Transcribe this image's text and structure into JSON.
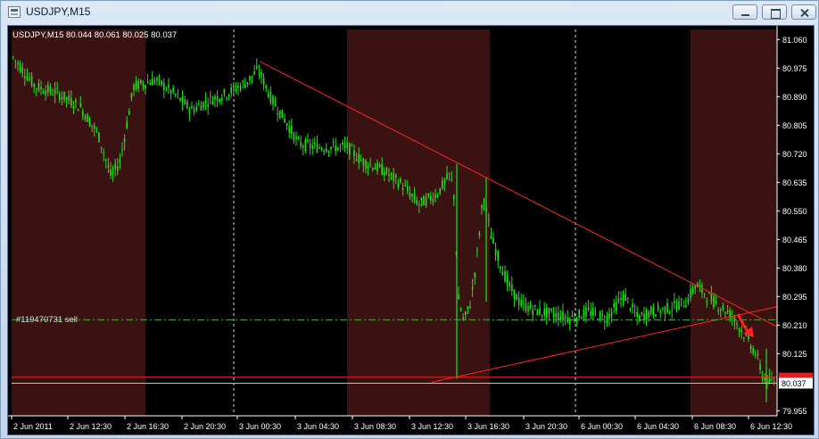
{
  "window": {
    "title": "USDJPY,M15"
  },
  "chart_data": {
    "type": "candlestick",
    "symbol_label": "USDJPY,M15",
    "ohlc_label": "80.044 80.061 80.025 80.037",
    "current_price": "80.037",
    "price_ticks": [
      "81.060",
      "80.975",
      "80.890",
      "80.805",
      "80.720",
      "80.635",
      "80.550",
      "80.465",
      "80.380",
      "80.295",
      "80.210",
      "80.125",
      "79.955"
    ],
    "time_ticks": [
      "2 Jun 2011",
      "2 Jun 12:30",
      "2 Jun 16:30",
      "2 Jun 20:30",
      "3 Jun 00:30",
      "3 Jun 04:30",
      "3 Jun 08:30",
      "3 Jun 12:30",
      "3 Jun 16:30",
      "3 Jun 20:30",
      "6 Jun 00:30",
      "6 Jun 04:30",
      "6 Jun 08:30",
      "6 Jun 12:30"
    ],
    "order_label": "#119470731 sell",
    "order_price": 80.226,
    "ylim": [
      79.94,
      81.09
    ],
    "trendlines": [
      {
        "from": [
          "3 Jun 00:30",
          80.995
        ],
        "to": [
          "6 Jun 12:30",
          80.205
        ],
        "color": "#ff2020"
      },
      {
        "from": [
          "3 Jun 12:30",
          80.04
        ],
        "to": [
          "6 Jun 12:30",
          80.265
        ],
        "color": "#ff2020"
      }
    ],
    "hlines": [
      {
        "price": 80.055,
        "color": "#ff2020"
      },
      {
        "price": 80.037,
        "color": "#c0c0c0"
      }
    ],
    "colors": {
      "background": "#000000",
      "session_shade": "#3a1212",
      "candle": "#22e01a",
      "order_line": "#2fb52f",
      "trendline": "#ff2020",
      "arrow": "#ff2020"
    },
    "arrow_icon": "red-down-arrow-icon"
  }
}
